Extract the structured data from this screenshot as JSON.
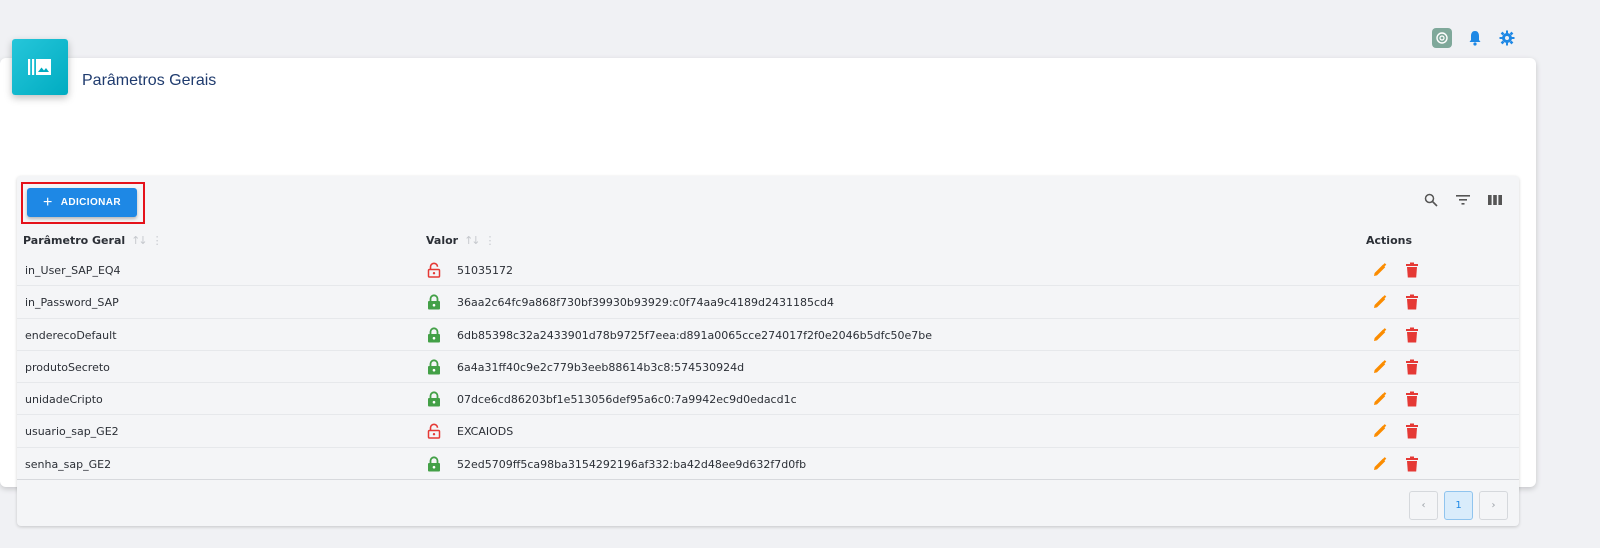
{
  "header": {
    "title": "Parâmetros Gerais",
    "icons": [
      "app-icon",
      "bell-icon",
      "gear-icon"
    ]
  },
  "toolbar": {
    "add_label": "ADICIONAR",
    "icons": [
      "search-icon",
      "filter-icon",
      "columns-icon"
    ]
  },
  "table": {
    "columns": [
      "Parâmetro Geral",
      "Valor",
      "Actions"
    ],
    "rows": [
      {
        "name": "in_User_SAP_EQ4",
        "value": "51035172",
        "encrypted": false
      },
      {
        "name": "in_Password_SAP",
        "value": "36aa2c64fc9a868f730bf39930b93929:c0f74aa9c4189d2431185cd4",
        "encrypted": true
      },
      {
        "name": "enderecoDefault",
        "value": "6db85398c32a2433901d78b9725f7eea:d891a0065cce274017f2f0e2046b5dfc50e7be",
        "encrypted": true
      },
      {
        "name": "produtoSecreto",
        "value": "6a4a31ff40c9e2c779b3eeb88614b3c8:574530924d",
        "encrypted": true
      },
      {
        "name": "unidadeCripto",
        "value": "07dce6cd86203bf1e513056def95a6c0:7a9942ec9d0edacd1c",
        "encrypted": true
      },
      {
        "name": "usuario_sap_GE2",
        "value": "EXCAIODS",
        "encrypted": false
      },
      {
        "name": "senha_sap_GE2",
        "value": "52ed5709ff5ca98ba3154292196af332:ba42d48ee9d632f7d0fb",
        "encrypted": true
      }
    ]
  },
  "pagination": {
    "prev": "‹",
    "current": "1",
    "next": "›"
  },
  "colors": {
    "primary": "#1e88e5",
    "title": "#1f3b6e",
    "locked": "#43a047",
    "unlocked": "#e53935",
    "edit": "#fb8c00",
    "delete": "#e53935",
    "highlight": "#e5121b"
  }
}
